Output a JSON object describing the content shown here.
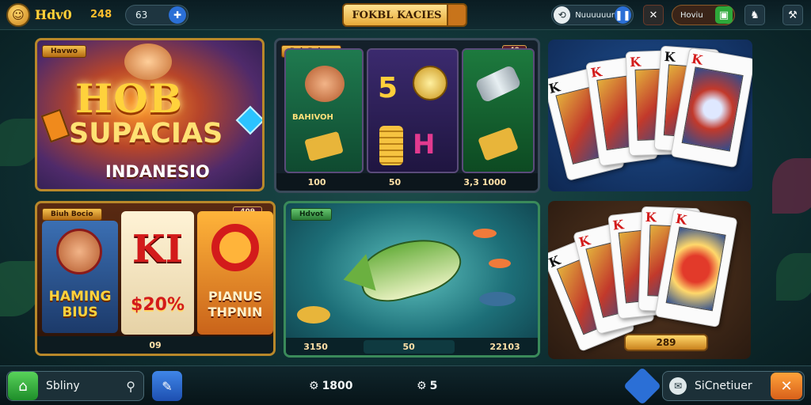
{
  "header": {
    "brand": "Hdv0",
    "brand_number": "248",
    "pill_left_value": "63",
    "center_banner": "FOKBL KACIES",
    "pill_right_value": "Nuuuuuur",
    "pill_right2_value": "Hoviu",
    "icons": [
      "avatar-icon",
      "plus-icon",
      "share-icon",
      "crossed-swords-icon",
      "gift-icon",
      "lobby-icon",
      "settings-icon"
    ]
  },
  "tiles": {
    "hero": {
      "tag": "Havwo",
      "title": "HOB",
      "subtitle": "SUPACIAS",
      "subtitle2": "INDANESIO"
    },
    "slots": {
      "tag": "Boh Babov",
      "tag_right": "49",
      "char_label": "BAHIVOH",
      "values": [
        "100",
        "50",
        "3,3 1000"
      ]
    },
    "hot_slots": {
      "tag": "Biuh Bocio",
      "tag_right": "409",
      "char_title": "HAMING BIUS",
      "reel_text_1": "$20%",
      "reel_text_2": "PIANUS THPNIN",
      "reel_symbol": "KI",
      "footer_value": "09"
    },
    "fishing": {
      "tag": "Hdvot",
      "values": [
        "3150",
        "50",
        "22103"
      ]
    },
    "cards_bottom": {
      "price": "289"
    }
  },
  "bottom": {
    "search_label": "Sbliny",
    "val1": "1800",
    "val2": "5",
    "right_label": "SiCnetiuer"
  },
  "colors": {
    "accent_gold": "#ffd23c",
    "btn_green": "#2ea83a",
    "btn_orange": "#f08a1c",
    "btn_blue": "#2b6fd6"
  }
}
